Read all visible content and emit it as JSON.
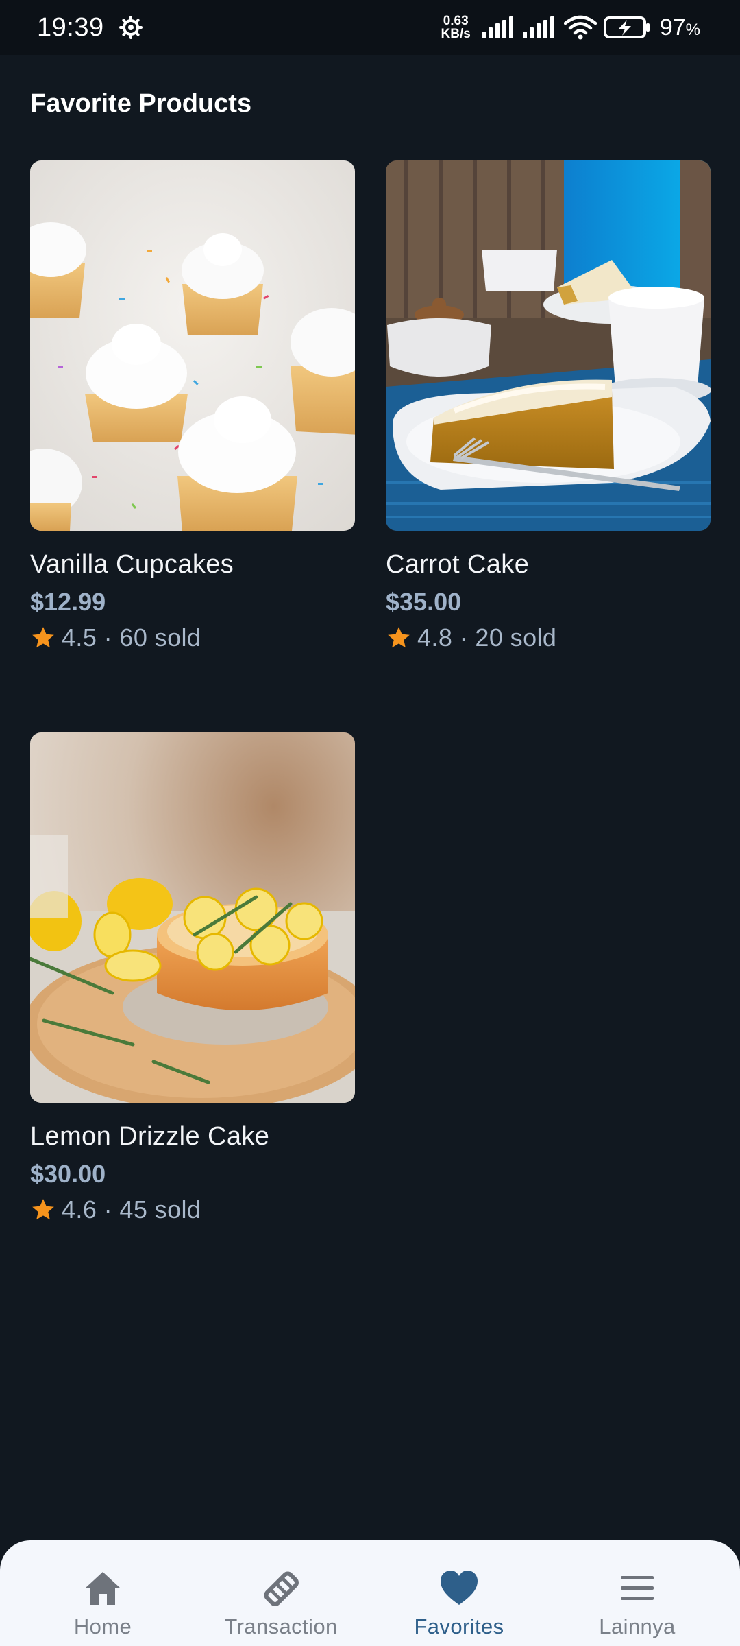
{
  "status_bar": {
    "time": "19:39",
    "net_speed_value": "0.63",
    "net_speed_unit": "KB/s",
    "battery_percent": "97",
    "battery_unit": "%"
  },
  "page": {
    "title": "Favorite Products"
  },
  "products": [
    {
      "name": "Vanilla Cupcakes",
      "price": "$12.99",
      "rating": "4.5 · 60 sold",
      "image": "vanilla-cupcakes-photo"
    },
    {
      "name": "Carrot Cake",
      "price": "$35.00",
      "rating": "4.8 · 20 sold",
      "image": "carrot-cake-photo"
    },
    {
      "name": "Lemon Drizzle Cake",
      "price": "$30.00",
      "rating": "4.6 · 45 sold",
      "image": "lemon-drizzle-cake-photo"
    }
  ],
  "nav": {
    "items": [
      {
        "label": "Home",
        "icon": "home-icon"
      },
      {
        "label": "Transaction",
        "icon": "handshake-icon"
      },
      {
        "label": "Favorites",
        "icon": "heart-icon"
      },
      {
        "label": "Lainnya",
        "icon": "menu-icon"
      }
    ],
    "active_label": "Favorites"
  },
  "colors": {
    "background": "#111820",
    "price": "#9fb2c9",
    "star": "#f7941d",
    "nav_active": "#2e5f8a",
    "nav_inactive": "#7a8089"
  }
}
